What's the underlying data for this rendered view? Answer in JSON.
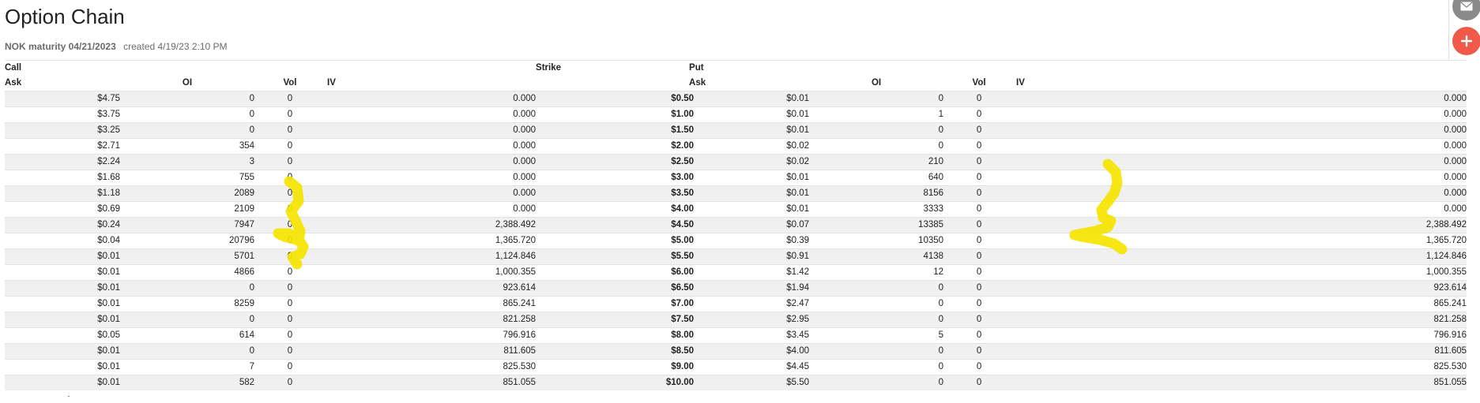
{
  "header": {
    "title": "Option Chain",
    "symbol": "NOK maturity 04/21/2023",
    "created": "created 4/19/23 2:10 PM"
  },
  "table": {
    "group_headers": {
      "call": "Call",
      "strike": "Strike",
      "put": "Put"
    },
    "columns": {
      "call_ask": "Ask",
      "call_oi": "OI",
      "call_vol": "Vol",
      "call_iv": "IV",
      "put_ask": "Ask",
      "put_oi": "OI",
      "put_vol": "Vol",
      "put_iv": "IV"
    },
    "rows": [
      {
        "call_ask": "$4.75",
        "call_oi": "0",
        "call_vol": "0",
        "call_iv": "0.000",
        "strike": "$0.50",
        "put_ask": "$0.01",
        "put_oi": "0",
        "put_vol": "0",
        "put_iv": "0.000"
      },
      {
        "call_ask": "$3.75",
        "call_oi": "0",
        "call_vol": "0",
        "call_iv": "0.000",
        "strike": "$1.00",
        "put_ask": "$0.01",
        "put_oi": "1",
        "put_vol": "0",
        "put_iv": "0.000"
      },
      {
        "call_ask": "$3.25",
        "call_oi": "0",
        "call_vol": "0",
        "call_iv": "0.000",
        "strike": "$1.50",
        "put_ask": "$0.01",
        "put_oi": "0",
        "put_vol": "0",
        "put_iv": "0.000"
      },
      {
        "call_ask": "$2.71",
        "call_oi": "354",
        "call_vol": "0",
        "call_iv": "0.000",
        "strike": "$2.00",
        "put_ask": "$0.02",
        "put_oi": "0",
        "put_vol": "0",
        "put_iv": "0.000"
      },
      {
        "call_ask": "$2.24",
        "call_oi": "3",
        "call_vol": "0",
        "call_iv": "0.000",
        "strike": "$2.50",
        "put_ask": "$0.02",
        "put_oi": "210",
        "put_vol": "0",
        "put_iv": "0.000"
      },
      {
        "call_ask": "$1.68",
        "call_oi": "755",
        "call_vol": "0",
        "call_iv": "0.000",
        "strike": "$3.00",
        "put_ask": "$0.01",
        "put_oi": "640",
        "put_vol": "0",
        "put_iv": "0.000"
      },
      {
        "call_ask": "$1.18",
        "call_oi": "2089",
        "call_vol": "0",
        "call_iv": "0.000",
        "strike": "$3.50",
        "put_ask": "$0.01",
        "put_oi": "8156",
        "put_vol": "0",
        "put_iv": "0.000"
      },
      {
        "call_ask": "$0.69",
        "call_oi": "2109",
        "call_vol": "0",
        "call_iv": "0.000",
        "strike": "$4.00",
        "put_ask": "$0.01",
        "put_oi": "3333",
        "put_vol": "0",
        "put_iv": "0.000"
      },
      {
        "call_ask": "$0.24",
        "call_oi": "7947",
        "call_vol": "0",
        "call_iv": "2,388.492",
        "strike": "$4.50",
        "put_ask": "$0.07",
        "put_oi": "13385",
        "put_vol": "0",
        "put_iv": "2,388.492"
      },
      {
        "call_ask": "$0.04",
        "call_oi": "20796",
        "call_vol": "0",
        "call_iv": "1,365.720",
        "strike": "$5.00",
        "put_ask": "$0.39",
        "put_oi": "10350",
        "put_vol": "0",
        "put_iv": "1,365.720"
      },
      {
        "call_ask": "$0.01",
        "call_oi": "5701",
        "call_vol": "0",
        "call_iv": "1,124.846",
        "strike": "$5.50",
        "put_ask": "$0.91",
        "put_oi": "4138",
        "put_vol": "0",
        "put_iv": "1,124.846"
      },
      {
        "call_ask": "$0.01",
        "call_oi": "4866",
        "call_vol": "0",
        "call_iv": "1,000.355",
        "strike": "$6.00",
        "put_ask": "$1.42",
        "put_oi": "12",
        "put_vol": "0",
        "put_iv": "1,000.355"
      },
      {
        "call_ask": "$0.01",
        "call_oi": "0",
        "call_vol": "0",
        "call_iv": "923.614",
        "strike": "$6.50",
        "put_ask": "$1.94",
        "put_oi": "0",
        "put_vol": "0",
        "put_iv": "923.614"
      },
      {
        "call_ask": "$0.01",
        "call_oi": "8259",
        "call_vol": "0",
        "call_iv": "865.241",
        "strike": "$7.00",
        "put_ask": "$2.47",
        "put_oi": "0",
        "put_vol": "0",
        "put_iv": "865.241"
      },
      {
        "call_ask": "$0.01",
        "call_oi": "0",
        "call_vol": "0",
        "call_iv": "821.258",
        "strike": "$7.50",
        "put_ask": "$2.95",
        "put_oi": "0",
        "put_vol": "0",
        "put_iv": "821.258"
      },
      {
        "call_ask": "$0.05",
        "call_oi": "614",
        "call_vol": "0",
        "call_iv": "796.916",
        "strike": "$8.00",
        "put_ask": "$3.45",
        "put_oi": "5",
        "put_vol": "0",
        "put_iv": "796.916"
      },
      {
        "call_ask": "$0.01",
        "call_oi": "0",
        "call_vol": "0",
        "call_iv": "811.605",
        "strike": "$8.50",
        "put_ask": "$4.00",
        "put_oi": "0",
        "put_vol": "0",
        "put_iv": "811.605"
      },
      {
        "call_ask": "$0.01",
        "call_oi": "7",
        "call_vol": "0",
        "call_iv": "825.530",
        "strike": "$9.00",
        "put_ask": "$4.45",
        "put_oi": "0",
        "put_vol": "0",
        "put_iv": "825.530"
      },
      {
        "call_ask": "$0.01",
        "call_oi": "582",
        "call_vol": "0",
        "call_iv": "851.055",
        "strike": "$10.00",
        "put_ask": "$5.50",
        "put_oi": "0",
        "put_vol": "0",
        "put_iv": "851.055"
      }
    ]
  },
  "fab": {
    "mail_icon": "envelope-icon",
    "add_icon": "plus-icon"
  },
  "colors": {
    "highlight": "#f5e400",
    "fab_add": "#ef5a4a",
    "fab_mail": "#8a8a8a",
    "row_stripe": "#f0f0f0"
  }
}
